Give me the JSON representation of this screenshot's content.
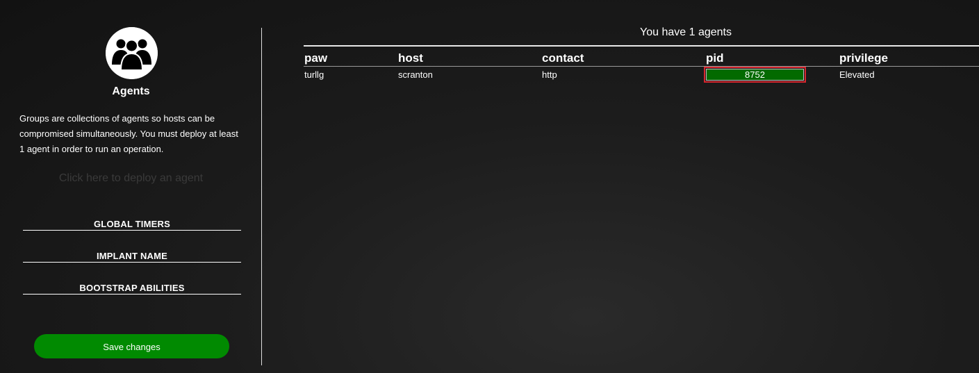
{
  "sidebar": {
    "icon": "users-group-icon",
    "title": "Agents",
    "description": "Groups are collections of agents so hosts can be compromised simultaneously. You must deploy at least 1 agent in order to run an operation.",
    "deploy_link": "Click here to deploy an agent",
    "sections": [
      {
        "label": "GLOBAL TIMERS"
      },
      {
        "label": "IMPLANT NAME"
      },
      {
        "label": "BOOTSTRAP ABILITIES"
      }
    ],
    "save_label": "Save changes"
  },
  "main": {
    "agent_count": "You have 1 agents",
    "columns": [
      "paw",
      "host",
      "contact",
      "pid",
      "privilege"
    ],
    "rows": [
      {
        "paw": "turllg",
        "host": "scranton",
        "contact": "http",
        "pid": "8752",
        "privilege": "Elevated"
      }
    ]
  },
  "colors": {
    "accent_green": "#018a01",
    "pid_highlight": "#036a00",
    "selection_outline": "#d7262e"
  }
}
